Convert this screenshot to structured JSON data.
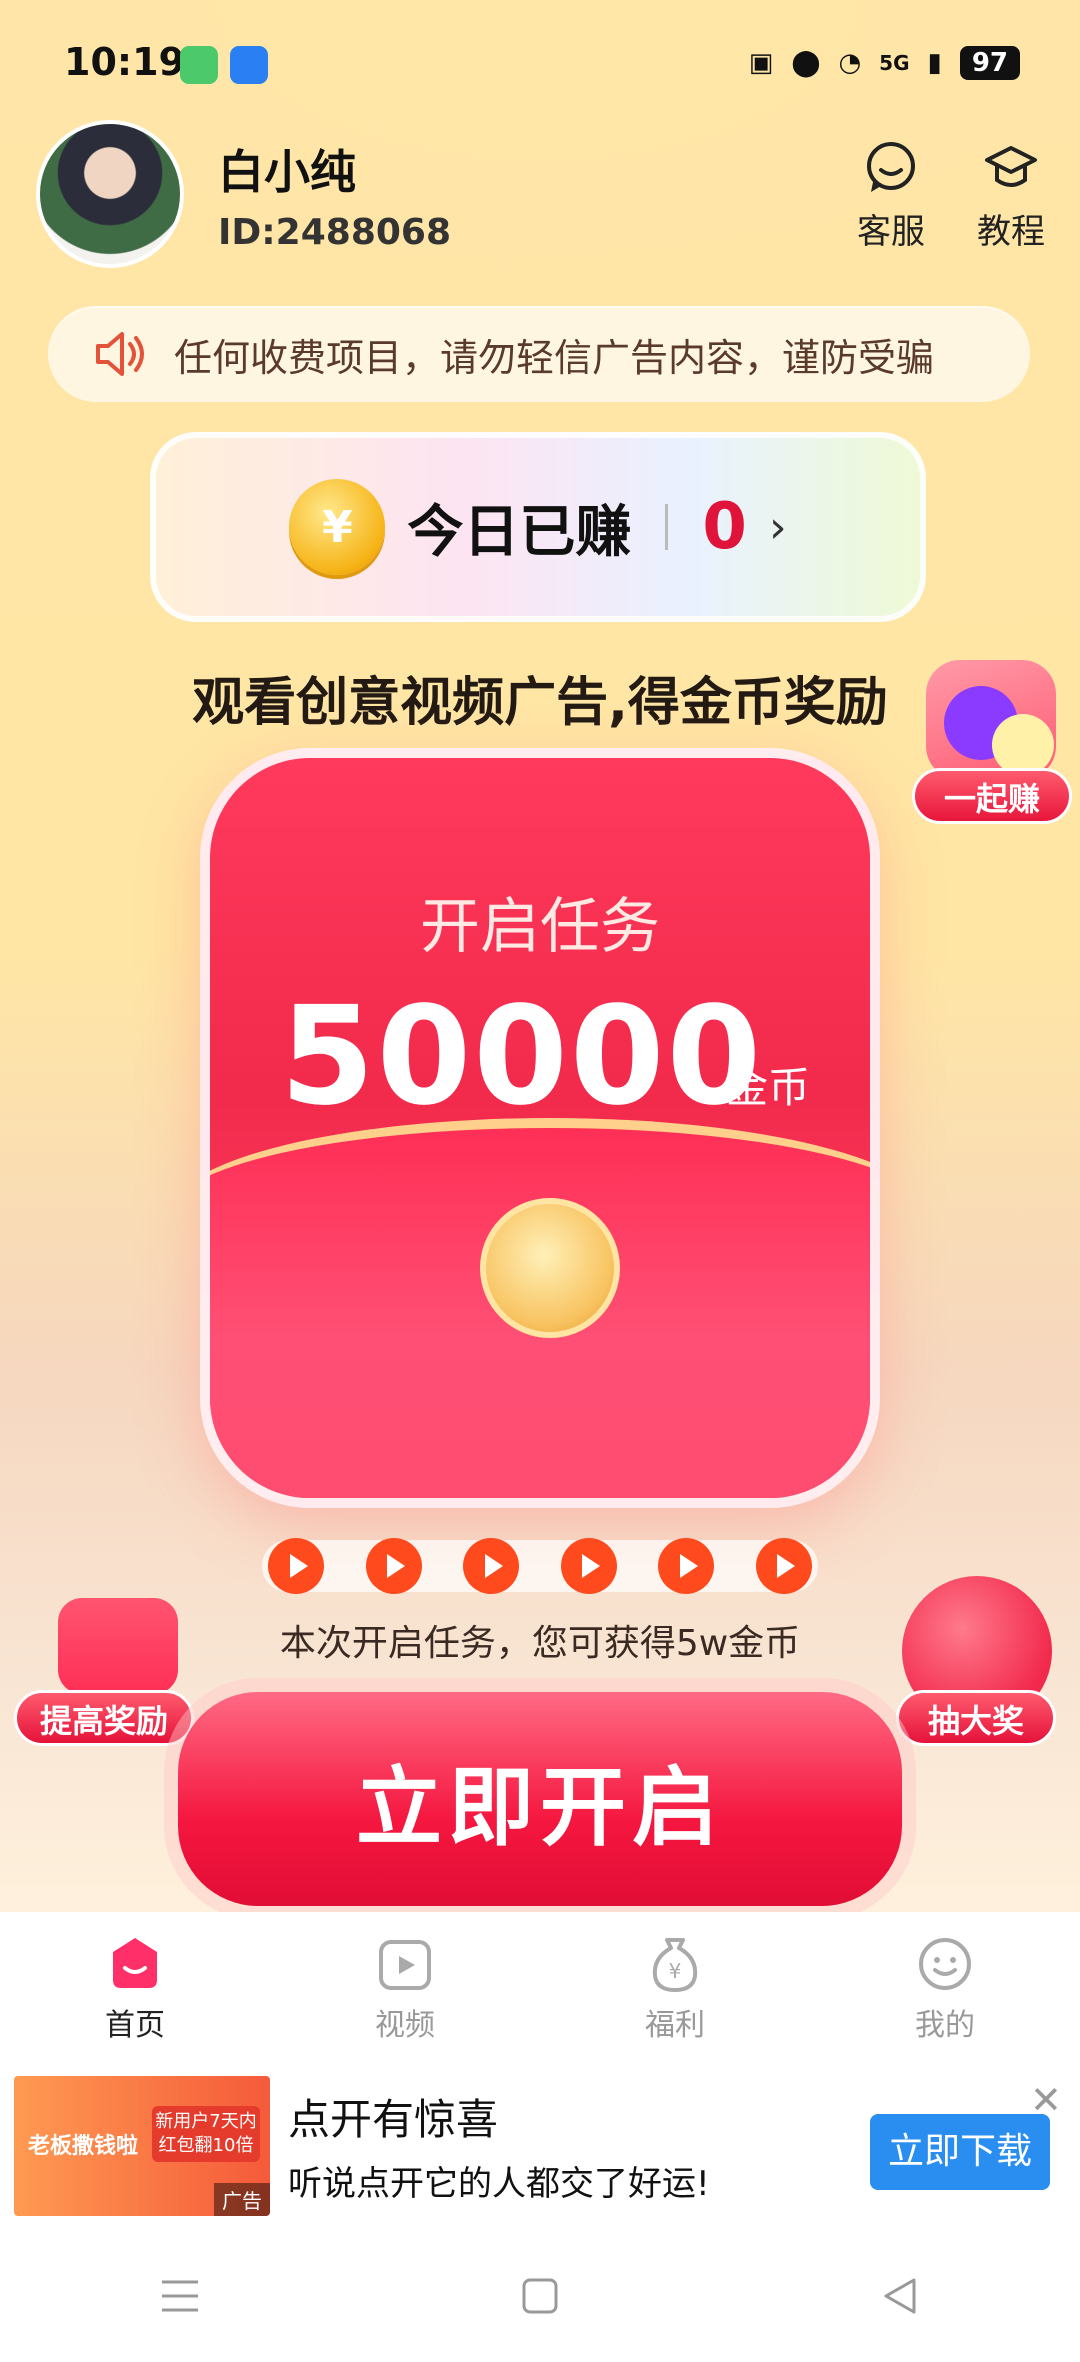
{
  "status_bar": {
    "time": "10:19",
    "network": "5G",
    "battery": "97"
  },
  "profile": {
    "name": "白小纯",
    "id": "ID:2488068"
  },
  "header_actions": [
    {
      "label": "客服"
    },
    {
      "label": "教程"
    }
  ],
  "notice": {
    "text": "任何收费项目，请勿轻信广告内容，谨防受骗"
  },
  "earned": {
    "label": "今日已赚",
    "value": "0",
    "coin_symbol": "¥"
  },
  "headline": "观看创意视频广告,得金币奖励",
  "together_badge": "一起赚",
  "task": {
    "title": "开启任务",
    "amount": "50000",
    "unit": "金币"
  },
  "tip": "本次开启任务，您可获得5w金币",
  "boost_badge": "提高奖励",
  "draw_badge": "抽大奖",
  "cta": "立即开启",
  "tabs": [
    {
      "label": "首页",
      "active": true
    },
    {
      "label": "视频",
      "active": false
    },
    {
      "label": "福利",
      "active": false
    },
    {
      "label": "我的",
      "active": false
    }
  ],
  "ad": {
    "thumb_text_1": "老板撒钱啦",
    "thumb_text_2": "新用户7天内红包翻10倍",
    "tag": "广告",
    "title": "点开有惊喜",
    "desc": "听说点开它的人都交了好运!",
    "download": "立即下载"
  },
  "colors": {
    "accent": "#f22a4c",
    "notice_text": "#5a3a2a",
    "download": "#2a8ef1"
  }
}
